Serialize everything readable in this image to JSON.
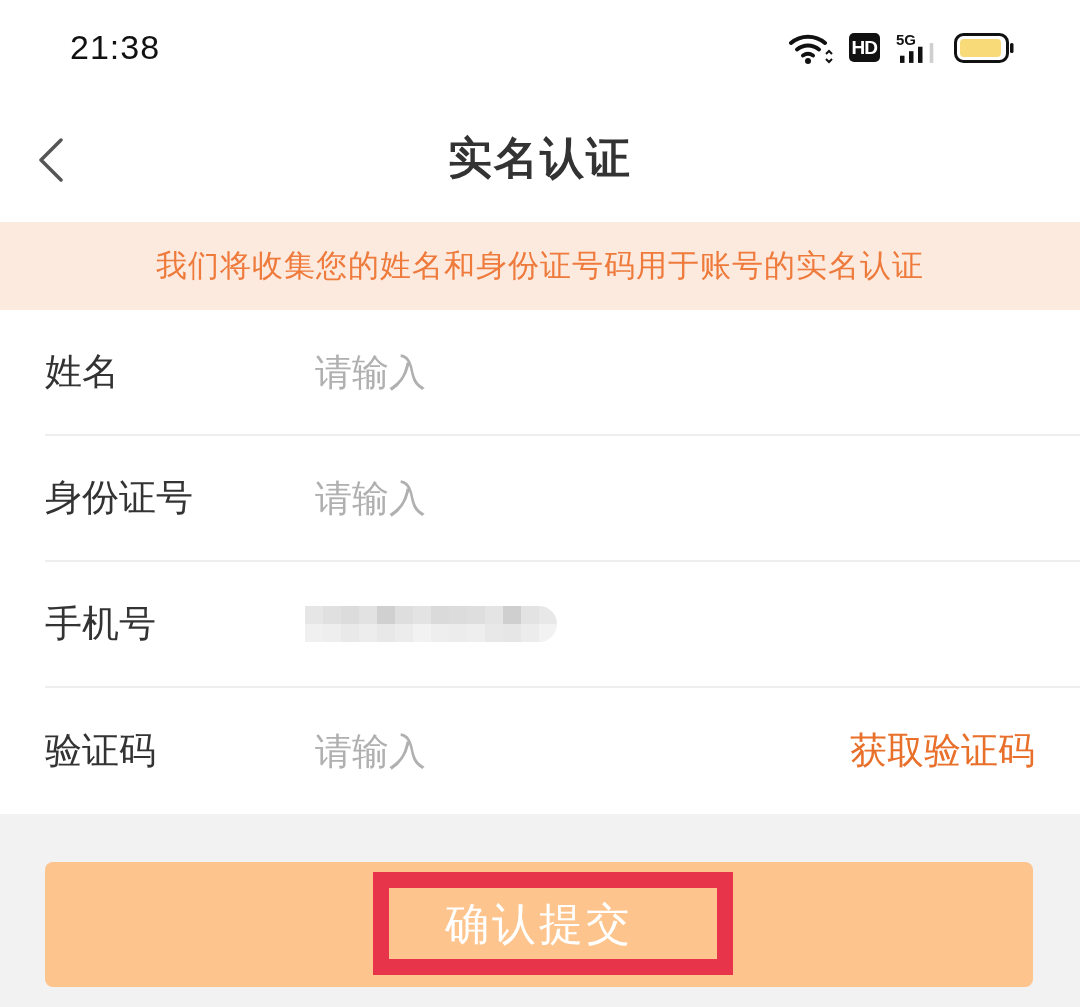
{
  "status_bar": {
    "time": "21:38",
    "hd_badge": "HD",
    "network": "5G"
  },
  "nav": {
    "title": "实名认证"
  },
  "notice": {
    "text": "我们将收集您的姓名和身份证号码用于账号的实名认证"
  },
  "form": {
    "rows": [
      {
        "kind": "input",
        "label": "姓名",
        "placeholder": "请输入"
      },
      {
        "kind": "input",
        "label": "身份证号",
        "placeholder": "请输入"
      },
      {
        "kind": "redacted",
        "label": "手机号"
      },
      {
        "kind": "input",
        "label": "验证码",
        "placeholder": "请输入",
        "action": "获取验证码"
      }
    ]
  },
  "submit": {
    "label": "确认提交",
    "highlighted": true
  }
}
